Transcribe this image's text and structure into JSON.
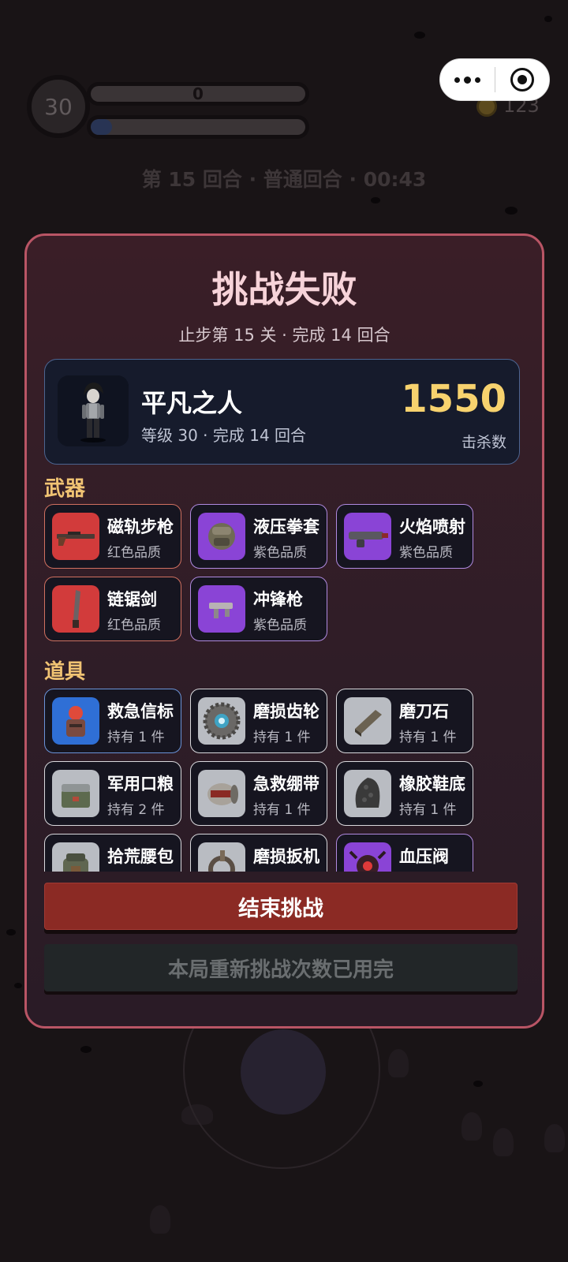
{
  "hud": {
    "level": "30",
    "score": "0",
    "exp_progress": 0.1,
    "coins": "123",
    "round_info": "第 15 回合 · 普通回合 · 00:43"
  },
  "capsule": {
    "more_icon": "more-dots-icon",
    "close_icon": "target-close-icon"
  },
  "result": {
    "title": "挑战失败",
    "subtitle": "止步第 15 关 · 完成 14 回合",
    "hero": {
      "name": "平凡之人",
      "meta": "等级 30 · 完成 14 回合",
      "kills": "1550",
      "kills_label": "击杀数"
    },
    "weapons_title": "武器",
    "weapons": [
      {
        "name": "磁轨步枪",
        "quality": "红色品质",
        "color": "#d23b3b",
        "border": "#d07060",
        "icon": "rifle-icon"
      },
      {
        "name": "液压拳套",
        "quality": "紫色品质",
        "color": "#8a44d6",
        "border": "#b08ae0",
        "icon": "gauntlet-icon"
      },
      {
        "name": "火焰喷射",
        "quality": "紫色品质",
        "color": "#8a44d6",
        "border": "#b08ae0",
        "icon": "flamethrower-icon"
      },
      {
        "name": "链锯剑",
        "quality": "红色品质",
        "color": "#d23b3b",
        "border": "#d07060",
        "icon": "chainsword-icon"
      },
      {
        "name": "冲锋枪",
        "quality": "紫色品质",
        "color": "#8a44d6",
        "border": "#b08ae0",
        "icon": "smg-icon"
      }
    ],
    "items_title": "道具",
    "items": [
      {
        "name": "救急信标",
        "count": "持有 1 件",
        "color": "#2f6fd6",
        "border": "#6a93d8",
        "icon": "beacon-icon"
      },
      {
        "name": "磨损齿轮",
        "count": "持有 1 件",
        "color": "#b9bcc2",
        "border": "#d8d8dc",
        "icon": "gear-icon"
      },
      {
        "name": "磨刀石",
        "count": "持有 1 件",
        "color": "#b9bcc2",
        "border": "#d8d8dc",
        "icon": "whetstone-icon"
      },
      {
        "name": "军用口粮",
        "count": "持有 2 件",
        "color": "#b9bcc2",
        "border": "#d8d8dc",
        "icon": "ration-icon"
      },
      {
        "name": "急救绷带",
        "count": "持有 1 件",
        "color": "#b9bcc2",
        "border": "#d8d8dc",
        "icon": "bandage-icon"
      },
      {
        "name": "橡胶鞋底",
        "count": "持有 1 件",
        "color": "#b9bcc2",
        "border": "#d8d8dc",
        "icon": "shoe-sole-icon"
      },
      {
        "name": "拾荒腰包",
        "count": "",
        "color": "#b9bcc2",
        "border": "#d8d8dc",
        "icon": "pouch-icon"
      },
      {
        "name": "磨损扳机",
        "count": "",
        "color": "#b9bcc2",
        "border": "#d8d8dc",
        "icon": "trigger-icon"
      },
      {
        "name": "血压阀",
        "count": "",
        "color": "#8a44d6",
        "border": "#b08ae0",
        "icon": "valve-icon"
      }
    ],
    "end_button": "结束挑战",
    "retry_button": "本局重新挑战次数已用完"
  }
}
